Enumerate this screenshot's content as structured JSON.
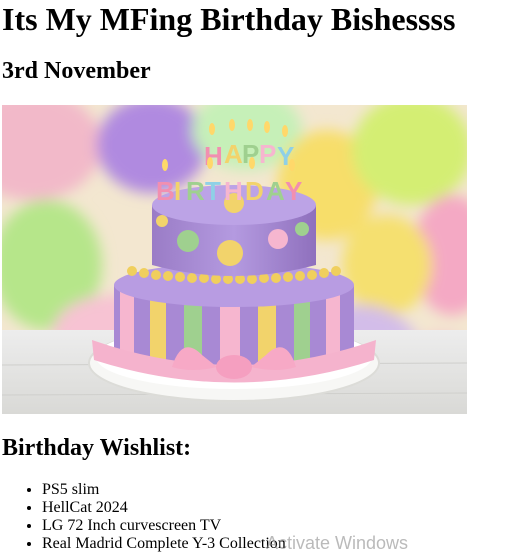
{
  "page": {
    "title": "Its My MFing Birthday Bishessss",
    "date": "3rd November"
  },
  "photo": {
    "candle_letters": [
      "H",
      "A",
      "P",
      "P",
      "Y",
      "B",
      "I",
      "R",
      "T",
      "H",
      "D",
      "A",
      "Y"
    ]
  },
  "wishlist": {
    "heading": "Birthday Wishlist:",
    "items": [
      "PS5 slim",
      "HellCat 2024",
      "LG 72 Inch curvescreen TV",
      "Real Madrid Complete Y-3 Collection"
    ]
  },
  "watermark": {
    "text": "Activate Windows"
  },
  "colors": {
    "cake_purple": "#a98bd3",
    "cake_pink": "#f6b6cf",
    "cake_yellow": "#f2d36b",
    "cake_green": "#9fd08f",
    "board_white": "#f4f4f2"
  }
}
